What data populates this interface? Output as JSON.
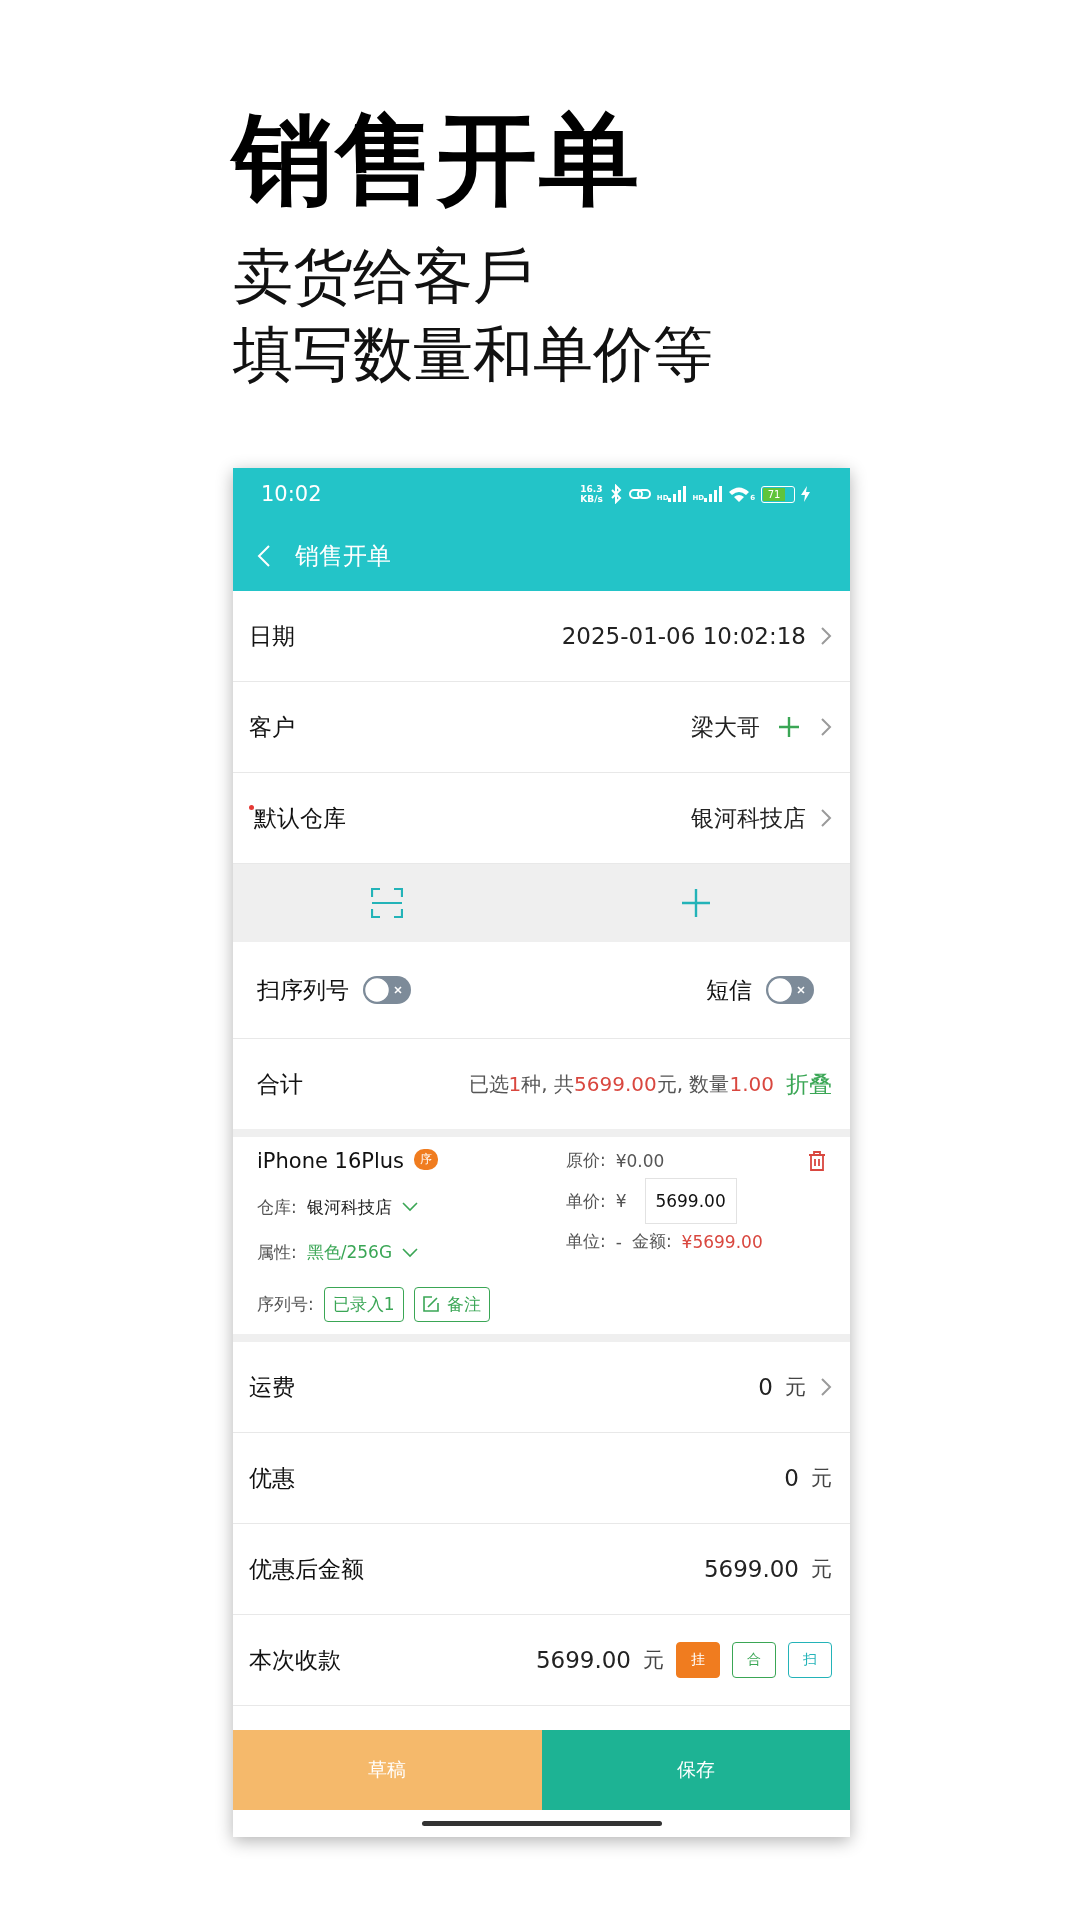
{
  "headline": {
    "title": "销售开单",
    "subtitle_lines": [
      "卖货给客戶",
      "填写数量和单价等"
    ]
  },
  "status_bar": {
    "time": "10:02",
    "speed_value": "16.3",
    "speed_unit": "KB/s",
    "signal_labels": [
      "HD",
      "HD"
    ],
    "wifi_label": "6",
    "battery": "71",
    "charging": true
  },
  "nav": {
    "title": "销售开单"
  },
  "form_rows": [
    {
      "label": "日期",
      "value": "2025-01-06 10:02:18",
      "required": false,
      "addable": false,
      "chevron": true
    },
    {
      "label": "客户",
      "value": "梁大哥",
      "required": false,
      "addable": true,
      "chevron": true
    },
    {
      "label": "默认仓库",
      "value": "银河科技店",
      "required": true,
      "addable": false,
      "chevron": true
    }
  ],
  "toggles": [
    {
      "label": "扫序列号",
      "on": false
    },
    {
      "label": "短信",
      "on": false
    }
  ],
  "summary": {
    "label": "合计",
    "parts": [
      {
        "text": "已选",
        "highlight": false
      },
      {
        "text": "1",
        "highlight": true
      },
      {
        "text": "种, 共",
        "highlight": false
      },
      {
        "text": "5699.00",
        "highlight": true
      },
      {
        "text": "元, 数量",
        "highlight": false
      },
      {
        "text": "1.00",
        "highlight": true
      }
    ],
    "action": "折叠"
  },
  "item": {
    "name": "iPhone 16Plus",
    "badge": "序",
    "warehouse_label": "仓库:",
    "warehouse": "银河科技店",
    "attr_label": "属性:",
    "attr": "黑色/256G",
    "serial_label": "序列号:",
    "serial_tag": "已录入1",
    "note": "备注",
    "orig_label": "原价:",
    "orig": "¥0.00",
    "price_label": "单价:",
    "price_currency": "¥",
    "price": "5699.00",
    "unit_label": "单位:",
    "unit": "-",
    "amount_label": "金额:",
    "amount": "¥5699.00"
  },
  "fee_rows": [
    {
      "label": "运费",
      "value": "0",
      "unit": "元",
      "chevron": true
    },
    {
      "label": "优惠",
      "value": "0",
      "unit": "元",
      "chevron": false
    },
    {
      "label": "优惠后金额",
      "value": "5699.00",
      "unit": "元",
      "chevron": false
    }
  ],
  "payment": {
    "label": "本次收款",
    "value": "5699.00",
    "unit": "元",
    "buttons": [
      {
        "label": "挂",
        "kind": "filled",
        "color": "#f07c1f"
      },
      {
        "label": "合",
        "kind": "outline",
        "color": "#3aa655"
      },
      {
        "label": "扫",
        "kind": "outline",
        "color": "#23b3b8"
      }
    ]
  },
  "bottom_buttons": [
    {
      "label": "草稿",
      "color": "#f5b96b"
    },
    {
      "label": "保存",
      "color": "#1db394"
    }
  ]
}
